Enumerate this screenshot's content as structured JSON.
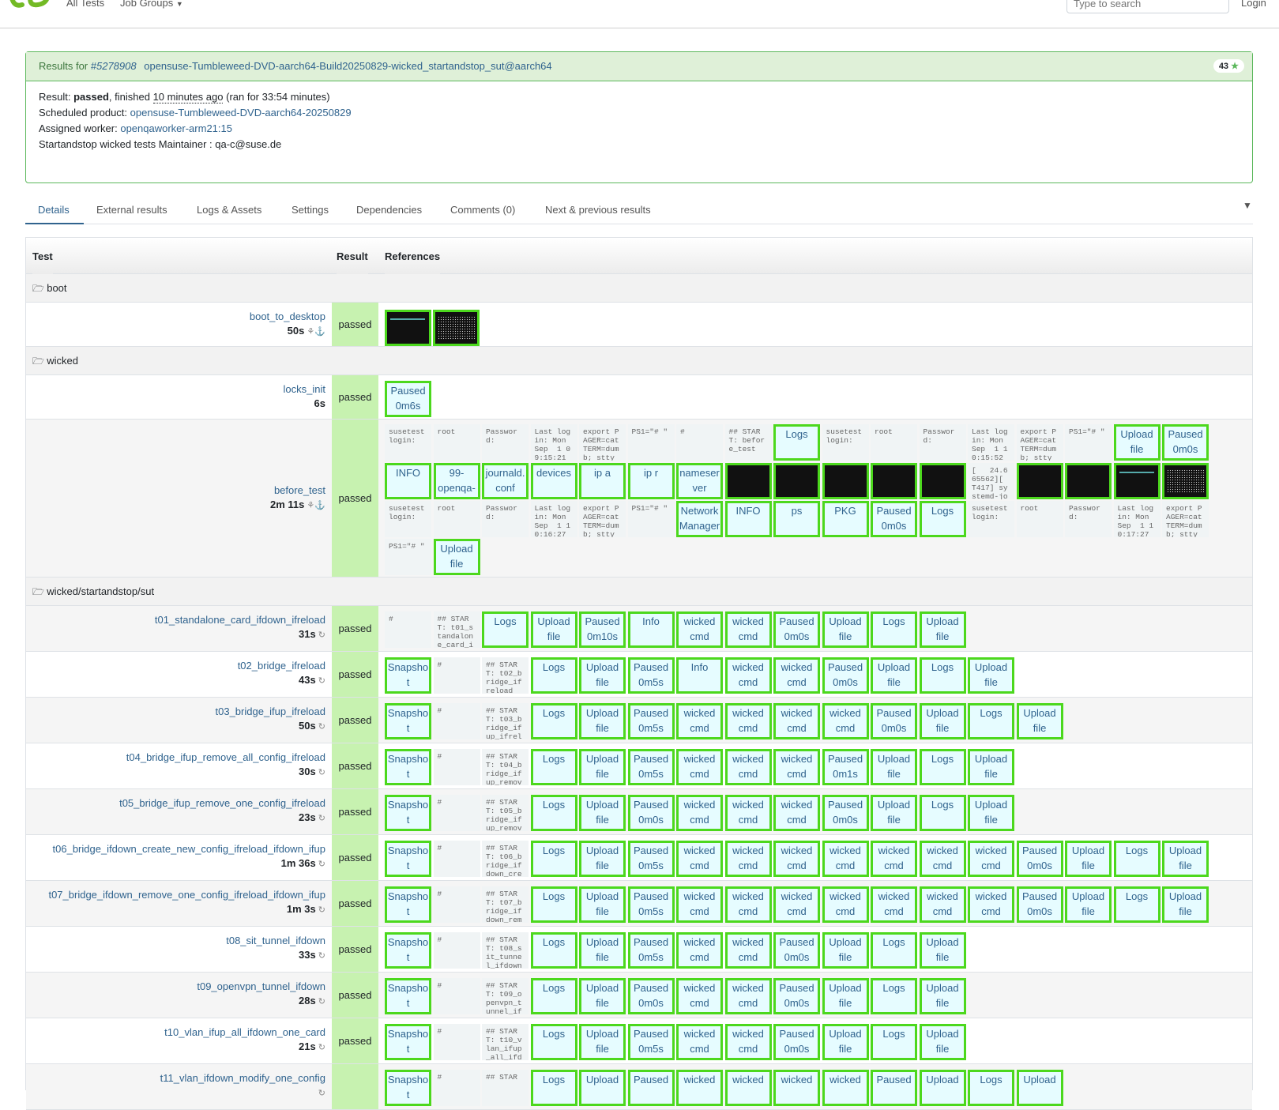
{
  "nav": {
    "all_tests": "All Tests",
    "job_groups": "Job Groups",
    "search_placeholder": "Type to search",
    "login": "Login"
  },
  "result": {
    "header_prefix": "Results for",
    "job_id": "#5278908",
    "job_name": "opensuse-Tumbleweed-DVD-aarch64-Build20250829-wicked_startandstop_sut@aarch64",
    "badge_count": "43",
    "result_label": "Result:",
    "result_value": "passed",
    "finished_text": ", finished",
    "finished_ago": "10 minutes ago",
    "ran_for": "(ran for 33:54 minutes)",
    "product_label": "Scheduled product:",
    "product_value": "opensuse-Tumbleweed-DVD-aarch64-20250829",
    "worker_label": "Assigned worker:",
    "worker_value": "openqaworker-arm21:15",
    "maintainer": "Startandstop wicked tests Maintainer : qa-c@suse.de"
  },
  "tabs": [
    "Details",
    "External results",
    "Logs & Assets",
    "Settings",
    "Dependencies",
    "Comments (0)",
    "Next & previous results"
  ],
  "table": {
    "headers": {
      "test": "Test",
      "result": "Result",
      "references": "References"
    },
    "categories": [
      "boot",
      "wicked",
      "wicked/startandstop/sut"
    ],
    "rows": [
      {
        "name": "boot_to_desktop",
        "duration": "50s",
        "result": "passed"
      },
      {
        "name": "locks_init",
        "duration": "6s",
        "result": "passed"
      },
      {
        "name": "before_test",
        "duration": "2m 11s",
        "result": "passed"
      },
      {
        "name": "t01_standalone_card_ifdown_ifreload",
        "duration": "31s",
        "result": "passed"
      },
      {
        "name": "t02_bridge_ifreload",
        "duration": "43s",
        "result": "passed"
      },
      {
        "name": "t03_bridge_ifup_ifreload",
        "duration": "50s",
        "result": "passed"
      },
      {
        "name": "t04_bridge_ifup_remove_all_config_ifreload",
        "duration": "30s",
        "result": "passed"
      },
      {
        "name": "t05_bridge_ifup_remove_one_config_ifreload",
        "duration": "23s",
        "result": "passed"
      },
      {
        "name": "t06_bridge_ifdown_create_new_config_ifreload_ifdown_ifup",
        "duration": "1m 36s",
        "result": "passed"
      },
      {
        "name": "t07_bridge_ifdown_remove_one_config_ifreload_ifdown_ifup",
        "duration": "1m 3s",
        "result": "passed"
      },
      {
        "name": "t08_sit_tunnel_ifdown",
        "duration": "33s",
        "result": "passed"
      },
      {
        "name": "t09_openvpn_tunnel_ifdown",
        "duration": "28s",
        "result": "passed"
      },
      {
        "name": "t10_vlan_ifup_all_ifdown_one_card",
        "duration": "21s",
        "result": "passed"
      },
      {
        "name": "t11_vlan_ifdown_modify_one_config",
        "duration": "",
        "result": ""
      }
    ],
    "refs": {
      "locks_init": [
        "Paused\n0m6s"
      ],
      "before_test_r1": [
        "susetest\nlogin:",
        "root",
        "Passwor\nd:",
        "Last log\nin: Mon\nSep  1 0\n9:15:21",
        "export P\nAGER=cat\nTERM=dum\nb; stty",
        "PS1=\"# \"",
        "#",
        "## STAR\nT: befor\ne_test",
        "Logs",
        "susetest\nlogin:",
        "root",
        "Passwor\nd:",
        "Last log\nin: Mon\nSep  1 1\n0:15:52",
        "export P\nAGER=cat\nTERM=dum\nb; stty",
        "PS1=\"# \"",
        "Upload\nfile",
        "Paused\n0m0s"
      ],
      "before_test_r2": [
        "INFO",
        "99-\nopenqa-",
        "journald.\nconf",
        "devices",
        "ip a",
        "ip r",
        "nameser\nver",
        "[   24.6\n65562][\nT417] sy\nstemd-jo"
      ],
      "before_test_r3": [
        "susetest\nlogin:",
        "root",
        "Passwor\nd:",
        "Last log\nin: Mon\nSep  1 1\n0:16:27",
        "export P\nAGER=cat\nTERM=dum\nb; stty",
        "PS1=\"# \"",
        "Network\nManager",
        "INFO",
        "ps",
        "PKG",
        "Paused\n0m0s",
        "Logs",
        "susetest\nlogin:",
        "root",
        "Passwor\nd:",
        "Last log\nin: Mon\nSep  1 1\n0:17:27",
        "export P\nAGER=cat\nTERM=dum\nb; stty"
      ],
      "before_test_r4": [
        "PS1=\"# \"",
        "Upload\nfile"
      ],
      "t01": [
        "#",
        "## STAR\nT: t01_s\ntandalon\ne_card_i",
        "Logs",
        "Upload\nfile",
        "Paused\n0m10s",
        "Info",
        "wicked\ncmd",
        "wicked\ncmd",
        "Paused\n0m0s",
        "Upload\nfile",
        "Logs",
        "Upload\nfile"
      ],
      "t02": [
        "Snapsho\nt",
        "#",
        "## STAR\nT: t02_b\nridge_if\nreload",
        "Logs",
        "Upload\nfile",
        "Paused\n0m5s",
        "Info",
        "wicked\ncmd",
        "wicked\ncmd",
        "Paused\n0m0s",
        "Upload\nfile",
        "Logs",
        "Upload\nfile"
      ],
      "t03": [
        "Snapsho\nt",
        "#",
        "## STAR\nT: t03_b\nridge_if\nup_ifrel",
        "Logs",
        "Upload\nfile",
        "Paused\n0m5s",
        "wicked\ncmd",
        "wicked\ncmd",
        "wicked\ncmd",
        "wicked\ncmd",
        "Paused\n0m0s",
        "Upload\nfile",
        "Logs",
        "Upload\nfile"
      ],
      "t04": [
        "Snapsho\nt",
        "#",
        "## STAR\nT: t04_b\nridge_if\nup_remov",
        "Logs",
        "Upload\nfile",
        "Paused\n0m5s",
        "wicked\ncmd",
        "wicked\ncmd",
        "wicked\ncmd",
        "Paused\n0m1s",
        "Upload\nfile",
        "Logs",
        "Upload\nfile"
      ],
      "t05": [
        "Snapsho\nt",
        "#",
        "## STAR\nT: t05_b\nridge_if\nup_remov",
        "Logs",
        "Upload\nfile",
        "Paused\n0m0s",
        "wicked\ncmd",
        "wicked\ncmd",
        "wicked\ncmd",
        "Paused\n0m0s",
        "Upload\nfile",
        "Logs",
        "Upload\nfile"
      ],
      "t06": [
        "Snapsho\nt",
        "#",
        "## STAR\nT: t06_b\nridge_if\ndown_cre",
        "Logs",
        "Upload\nfile",
        "Paused\n0m5s",
        "wicked\ncmd",
        "wicked\ncmd",
        "wicked\ncmd",
        "wicked\ncmd",
        "wicked\ncmd",
        "wicked\ncmd",
        "wicked\ncmd",
        "Paused\n0m0s",
        "Upload\nfile",
        "Logs",
        "Upload\nfile"
      ],
      "t07": [
        "Snapsho\nt",
        "#",
        "## STAR\nT: t07_b\nridge_if\ndown_rem",
        "Logs",
        "Upload\nfile",
        "Paused\n0m5s",
        "wicked\ncmd",
        "wicked\ncmd",
        "wicked\ncmd",
        "wicked\ncmd",
        "wicked\ncmd",
        "wicked\ncmd",
        "wicked\ncmd",
        "Paused\n0m0s",
        "Upload\nfile",
        "Logs",
        "Upload\nfile"
      ],
      "t08": [
        "Snapsho\nt",
        "#",
        "## STAR\nT: t08_s\nit_tunne\nl_ifdown",
        "Logs",
        "Upload\nfile",
        "Paused\n0m5s",
        "wicked\ncmd",
        "wicked\ncmd",
        "Paused\n0m0s",
        "Upload\nfile",
        "Logs",
        "Upload\nfile"
      ],
      "t09": [
        "Snapsho\nt",
        "#",
        "## STAR\nT: t09_o\npenvpn_t\nunnel_if",
        "Logs",
        "Upload\nfile",
        "Paused\n0m0s",
        "wicked\ncmd",
        "wicked\ncmd",
        "Paused\n0m0s",
        "Upload\nfile",
        "Logs",
        "Upload\nfile"
      ],
      "t10": [
        "Snapsho\nt",
        "#",
        "## STAR\nT: t10_v\nlan_ifup\n_all_ifd",
        "Logs",
        "Upload\nfile",
        "Paused\n0m5s",
        "wicked\ncmd",
        "wicked\ncmd",
        "Paused\n0m0s",
        "Upload\nfile",
        "Logs",
        "Upload\nfile"
      ],
      "t11": [
        "Snapsho\nt",
        "#",
        "## STAR",
        "Logs",
        "Upload",
        "Paused",
        "wicked",
        "wicked",
        "wicked",
        "wicked",
        "Paused",
        "Upload",
        "Logs",
        "Upload"
      ]
    }
  },
  "colors": {
    "accent": "#30638e",
    "pass_cell": "#c7f2b0",
    "ref_border": "#4cd81d",
    "ref_bg": "#e6fcff",
    "card_border": "#5cb85c"
  }
}
